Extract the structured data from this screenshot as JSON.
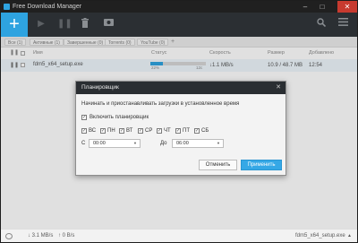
{
  "window": {
    "title": "Free Download Manager"
  },
  "tabs": [
    "Все (1)",
    "Активные (1)",
    "Завершенные (0)",
    "Torrents (0)",
    "YouTube (0)",
    "+"
  ],
  "columns": {
    "name": "Имя",
    "status": "Статус",
    "speed": "Скорость",
    "size": "Размер",
    "added": "Добавлено"
  },
  "download": {
    "name": "fdm5_x64_setup.exe",
    "percent_label": "22%",
    "progress": 0.22,
    "remaining": "12с",
    "speed": "↓1.1 MB/s",
    "size": "10.9 / 48.7 MB",
    "added": "12:54"
  },
  "status_bar": {
    "down": "↓ 3.1 MB/s",
    "up": "↑ 0 B/s",
    "file": "fdm5_x64_setup.exe"
  },
  "dialog": {
    "title": "Планировщик",
    "description": "Начинать и приостанавливать загрузки в установленное время",
    "enable_label": "Включить планировщик",
    "days": [
      "ВС",
      "ПН",
      "ВТ",
      "СР",
      "ЧТ",
      "ПТ",
      "СБ"
    ],
    "from_label": "С",
    "from_time": "00:00",
    "to_label": "До",
    "to_time": "06:00",
    "cancel": "Отменить",
    "apply": "Применить"
  },
  "colors": {
    "accent": "#2ea3e0",
    "toolbar": "#2b2f33",
    "titlebar": "#202020"
  },
  "icons": {
    "add": "plus-icon",
    "play": "play-icon",
    "pause": "pause-icon",
    "delete": "trash-icon",
    "folder": "folder-icon",
    "search": "search-icon",
    "menu": "hamburger-icon",
    "close": "close-icon"
  }
}
